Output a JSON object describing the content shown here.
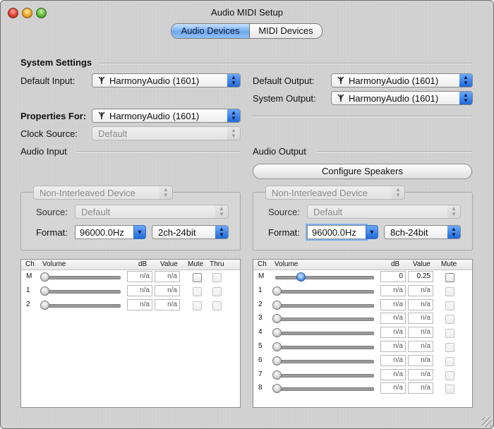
{
  "window": {
    "title": "Audio MIDI Setup"
  },
  "tabs": {
    "audio_devices": "Audio Devices",
    "midi_devices": "MIDI Devices"
  },
  "system_settings": {
    "heading": "System Settings",
    "default_input_label": "Default Input:",
    "default_input_value": "HarmonyAudio (1601)",
    "default_output_label": "Default Output:",
    "default_output_value": "HarmonyAudio (1601)",
    "system_output_label": "System Output:",
    "system_output_value": "HarmonyAudio (1601)"
  },
  "properties": {
    "properties_for_label": "Properties For:",
    "properties_for_value": "HarmonyAudio (1601)",
    "clock_source_label": "Clock Source:",
    "clock_source_value": "Default"
  },
  "audio_input": {
    "heading": "Audio Input",
    "device_mode": "Non-Interleaved Device",
    "source_label": "Source:",
    "source_value": "Default",
    "format_label": "Format:",
    "rate_value": "96000.0Hz",
    "channels_value": "2ch-24bit",
    "headers": {
      "ch": "Ch",
      "volume": "Volume",
      "db": "dB",
      "value": "Value",
      "mute": "Mute",
      "thru": "Thru"
    },
    "rows": [
      {
        "ch": "M",
        "db": "n/a",
        "value": "n/a",
        "volume_level": 0
      },
      {
        "ch": "1",
        "db": "n/a",
        "value": "n/a",
        "volume_level": 0
      },
      {
        "ch": "2",
        "db": "n/a",
        "value": "n/a",
        "volume_level": 0
      }
    ]
  },
  "audio_output": {
    "heading": "Audio Output",
    "configure_button": "Configure Speakers",
    "device_mode": "Non-Interleaved Device",
    "source_label": "Source:",
    "source_value": "Default",
    "format_label": "Format:",
    "rate_value": "96000.0Hz",
    "channels_value": "8ch-24bit",
    "headers": {
      "ch": "Ch",
      "volume": "Volume",
      "db": "dB",
      "value": "Value",
      "mute": "Mute"
    },
    "rows": [
      {
        "ch": "M",
        "db": "0",
        "value": "0.25",
        "volume_level": 0.25
      },
      {
        "ch": "1",
        "db": "n/a",
        "value": "n/a",
        "volume_level": 0
      },
      {
        "ch": "2",
        "db": "n/a",
        "value": "n/a",
        "volume_level": 0
      },
      {
        "ch": "3",
        "db": "n/a",
        "value": "n/a",
        "volume_level": 0
      },
      {
        "ch": "4",
        "db": "n/a",
        "value": "n/a",
        "volume_level": 0
      },
      {
        "ch": "5",
        "db": "n/a",
        "value": "n/a",
        "volume_level": 0
      },
      {
        "ch": "6",
        "db": "n/a",
        "value": "n/a",
        "volume_level": 0
      },
      {
        "ch": "7",
        "db": "n/a",
        "value": "n/a",
        "volume_level": 0
      },
      {
        "ch": "8",
        "db": "n/a",
        "value": "n/a",
        "volume_level": 0
      }
    ]
  },
  "icons": {
    "device_icon": "firewire-icon",
    "popup_arrows": "updown-arrows-icon",
    "combo_arrow": "down-arrow-icon"
  },
  "colors": {
    "accent": "#3b82f6",
    "text": "#111111",
    "disabled_text": "#8a8a8a"
  }
}
